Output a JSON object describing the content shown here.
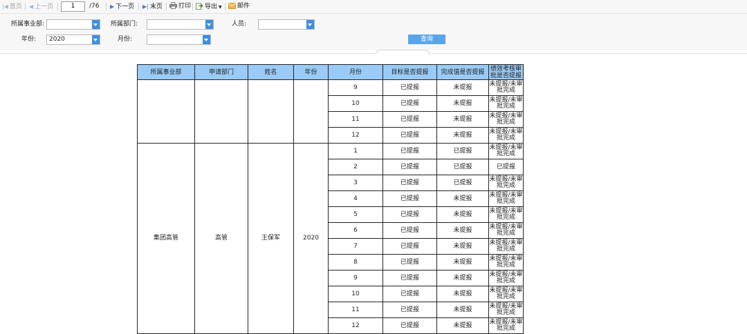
{
  "toolbar": {
    "first": "首页",
    "prev": "上一页",
    "page_value": "1",
    "page_total": "/76",
    "next": "下一页",
    "last": "末页",
    "print": "打印",
    "export": "导出",
    "mail": "邮件"
  },
  "filters": {
    "division_label": "所属事业部:",
    "division_value": "",
    "dept_label": "所属部门:",
    "dept_value": "",
    "person_label": "人员:",
    "person_value": "",
    "year_label": "年份:",
    "year_value": "2020",
    "month_label": "月份:",
    "month_value": "",
    "query_button": "查询"
  },
  "table": {
    "headers": [
      "所属事业部",
      "申请部门",
      "姓名",
      "年份",
      "月份",
      "目标是否提报",
      "完成值是否提报",
      "绩效考核审批是否提报"
    ],
    "group1_rows": [
      {
        "month": "9",
        "target": "已提报",
        "done": "未提报",
        "review": "未提报/未审批完成"
      },
      {
        "month": "10",
        "target": "已提报",
        "done": "未提报",
        "review": "未提报/未审批完成"
      },
      {
        "month": "11",
        "target": "已提报",
        "done": "未提报",
        "review": "未提报/未审批完成"
      },
      {
        "month": "12",
        "target": "已提报",
        "done": "未提报",
        "review": "未提报/未审批完成"
      }
    ],
    "group2": {
      "division": "集团高管",
      "dept": "高管",
      "name": "王保军",
      "year": "2020"
    },
    "group2_rows": [
      {
        "month": "1",
        "target": "已提报",
        "done": "已提报",
        "review": "未提报/未审批完成"
      },
      {
        "month": "2",
        "target": "已提报",
        "done": "已提报",
        "review": "已提报"
      },
      {
        "month": "3",
        "target": "已提报",
        "done": "已提报",
        "review": "未提报/未审批完成"
      },
      {
        "month": "4",
        "target": "已提报",
        "done": "未提报",
        "review": "未提报/未审批完成"
      },
      {
        "month": "5",
        "target": "已提报",
        "done": "未提报",
        "review": "未提报/未审批完成"
      },
      {
        "month": "6",
        "target": "已提报",
        "done": "未提报",
        "review": "未提报/未审批完成"
      },
      {
        "month": "7",
        "target": "已提报",
        "done": "未提报",
        "review": "未提报/未审批完成"
      },
      {
        "month": "8",
        "target": "已提报",
        "done": "未提报",
        "review": "未提报/未审批完成"
      },
      {
        "month": "9",
        "target": "已提报",
        "done": "未提报",
        "review": "未提报/未审批完成"
      },
      {
        "month": "10",
        "target": "已提报",
        "done": "未提报",
        "review": "未提报/未审批完成"
      },
      {
        "month": "11",
        "target": "已提报",
        "done": "未提报",
        "review": "未提报/未审批完成"
      },
      {
        "month": "12",
        "target": "已提报",
        "done": "未提报",
        "review": "未提报/未审批完成"
      }
    ]
  },
  "colors": {
    "header_bg": "#9acbf6",
    "dropdown_button": "#3d8fe1",
    "query_button": "#5aa5e9"
  }
}
